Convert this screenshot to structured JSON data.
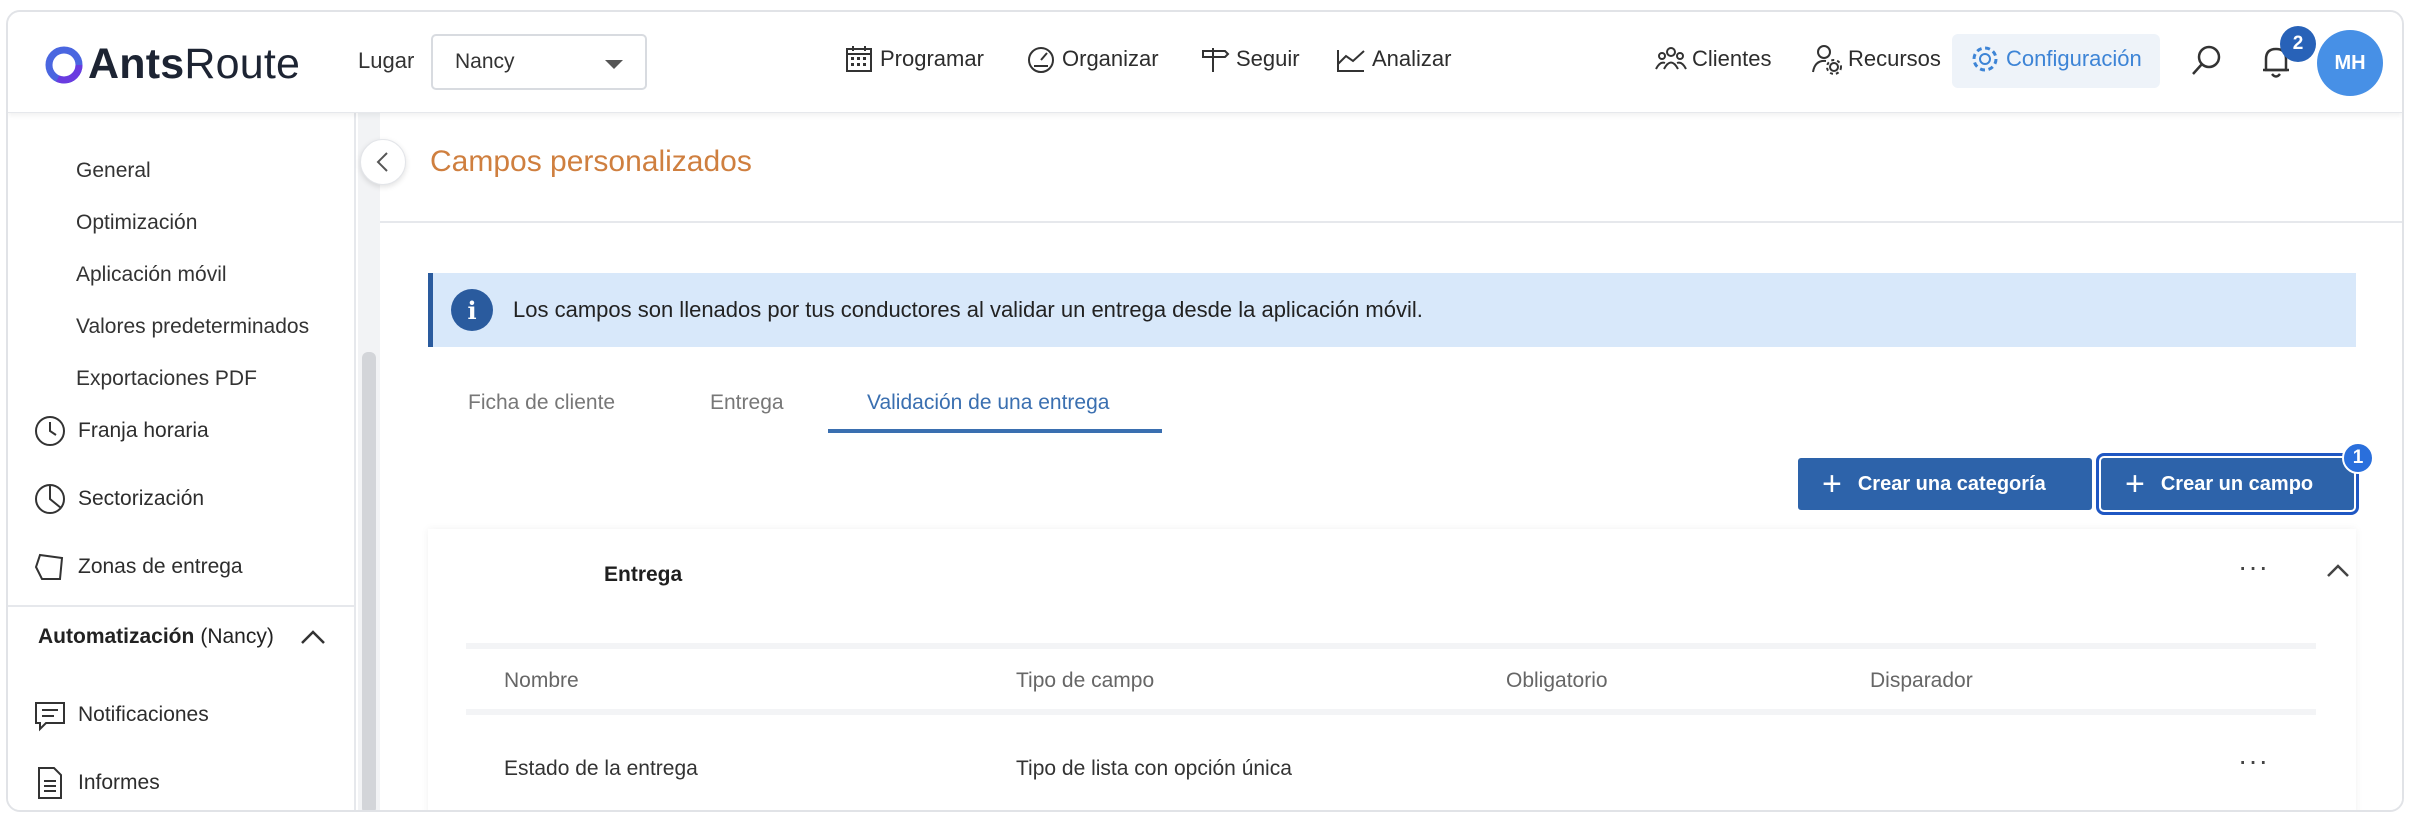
{
  "header": {
    "logo": {
      "bold": "Ants",
      "light": "Route"
    },
    "lugar_label": "Lugar",
    "lugar_value": "Nancy",
    "nav": [
      {
        "label": "Programar",
        "icon": "calendar-icon"
      },
      {
        "label": "Organizar",
        "icon": "speedometer-icon"
      },
      {
        "label": "Seguir",
        "icon": "signpost-icon"
      },
      {
        "label": "Analizar",
        "icon": "chart-icon"
      }
    ],
    "right_nav": [
      {
        "label": "Clientes",
        "icon": "users-icon"
      },
      {
        "label": "Recursos",
        "icon": "user-gear-icon"
      },
      {
        "label": "Configuración",
        "icon": "gear-icon",
        "active": true
      }
    ],
    "notifications_count": "2",
    "avatar_initials": "MH",
    "accent_color": "#4790e6"
  },
  "sidebar": {
    "sub_items": [
      "General",
      "Optimización",
      "Aplicación móvil",
      "Valores predeterminados",
      "Exportaciones PDF"
    ],
    "items": [
      {
        "label": "Franja horaria",
        "icon": "clock-icon"
      },
      {
        "label": "Sectorización",
        "icon": "pie-icon"
      },
      {
        "label": "Zonas de entrega",
        "icon": "polygon-icon"
      }
    ],
    "section": {
      "bold": "Automatización",
      "rest": "(Nancy)"
    },
    "section_items": [
      {
        "label": "Notificaciones",
        "icon": "message-icon"
      },
      {
        "label": "Informes",
        "icon": "document-icon"
      }
    ]
  },
  "main": {
    "page_title": "Campos personalizados",
    "info_text": "Los campos son llenados por tus conductores al validar un entrega desde la aplicación móvil.",
    "tabs": [
      "Ficha de cliente",
      "Entrega",
      "Validación de una entrega"
    ],
    "active_tab": "Validación de una entrega",
    "buttons": {
      "create_category": "Crear una categoría",
      "create_field": "Crear un campo",
      "create_field_badge": "1"
    },
    "category": "Entrega",
    "columns": [
      "Nombre",
      "Tipo de campo",
      "Obligatorio",
      "Disparador"
    ],
    "rows": [
      {
        "nombre": "Estado de la entrega",
        "tipo": "Tipo de lista con opción única",
        "obligatorio": "",
        "disparador": ""
      }
    ]
  }
}
